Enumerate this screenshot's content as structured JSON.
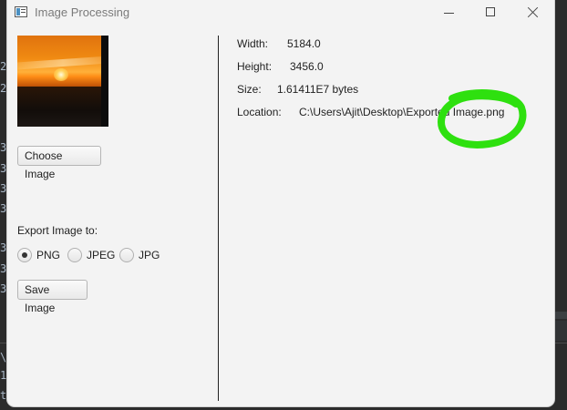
{
  "window": {
    "title": "Image Processing"
  },
  "left_panel": {
    "choose_button": "Choose Image",
    "export_label": "Export Image to:",
    "formats": [
      {
        "label": "PNG",
        "selected": true
      },
      {
        "label": "JPEG",
        "selected": false
      },
      {
        "label": "JPG",
        "selected": false
      }
    ],
    "save_button": "Save Image"
  },
  "info": {
    "width_label": "Width:",
    "width_value": "5184.0",
    "height_label": "Height:",
    "height_value": "3456.0",
    "size_label": "Size:",
    "size_value": "1.61411E7 bytes",
    "location_label": "Location:",
    "location_value": "C:\\Users\\Ajit\\Desktop\\Exported Image.png"
  },
  "background_gutter": [
    "2",
    "2",
    "3",
    "3",
    "3",
    "3",
    "3",
    "3",
    "3",
    "\\",
    "1",
    "t"
  ],
  "colors": {
    "annotation": "#2ee00f",
    "window_bg": "#f3f3f3",
    "ide_bg": "#2b2b2b"
  }
}
